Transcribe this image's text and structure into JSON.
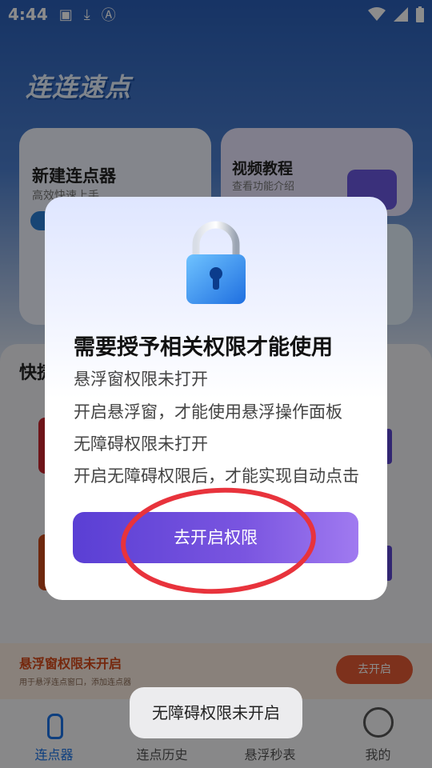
{
  "status_bar": {
    "time": "4:44",
    "icons": [
      "image-icon",
      "download-icon",
      "font-icon",
      "wifi-icon",
      "signal-icon",
      "battery-icon"
    ]
  },
  "app": {
    "logo_text": "连连速点",
    "card_new": {
      "title": "新建连点器",
      "subtitle": "高效快速上手"
    },
    "card_video": {
      "title": "视频教程",
      "subtitle": "查看功能介绍"
    },
    "quick_section_title": "快捷",
    "warning": {
      "title": "悬浮窗权限未开启",
      "subtitle": "用于悬浮连点窗口，添加连点器",
      "button": "去开启"
    },
    "tabs": [
      {
        "label": "连点器",
        "active": true
      },
      {
        "label": "连点历史",
        "active": false
      },
      {
        "label": "悬浮秒表",
        "active": false
      },
      {
        "label": "我的",
        "active": false
      }
    ]
  },
  "dialog": {
    "title": "需要授予相关权限才能使用",
    "lines": [
      "悬浮窗权限未打开",
      "开启悬浮窗，才能使用悬浮操作面板",
      "无障碍权限未打开",
      "开启无障碍权限后，才能实现自动点击"
    ],
    "button": "去开启权限"
  },
  "toast": "无障碍权限未开启",
  "colors": {
    "accent": "#5a3fd4",
    "warning": "#d54a1a",
    "annotation": "#e8333c"
  }
}
